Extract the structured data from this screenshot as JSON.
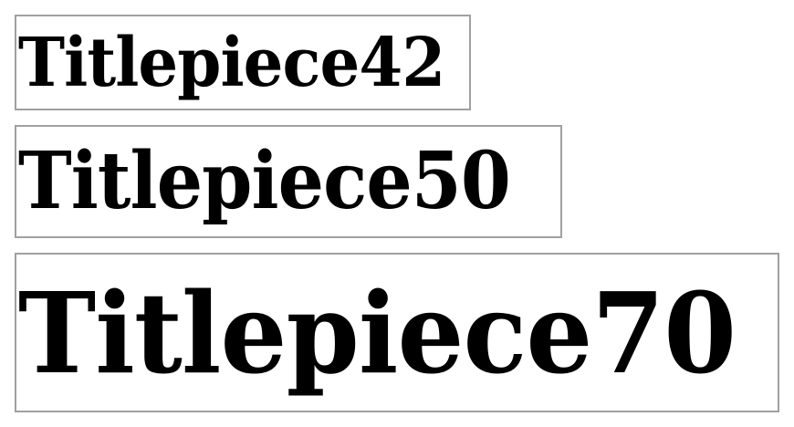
{
  "specimens": [
    {
      "text": "Titlepiece42"
    },
    {
      "text": "Titlepiece50"
    },
    {
      "text": "Titlepiece70"
    }
  ],
  "colors": {
    "text": "#000000",
    "border": "#a0a0a0",
    "background": "#ffffff"
  }
}
